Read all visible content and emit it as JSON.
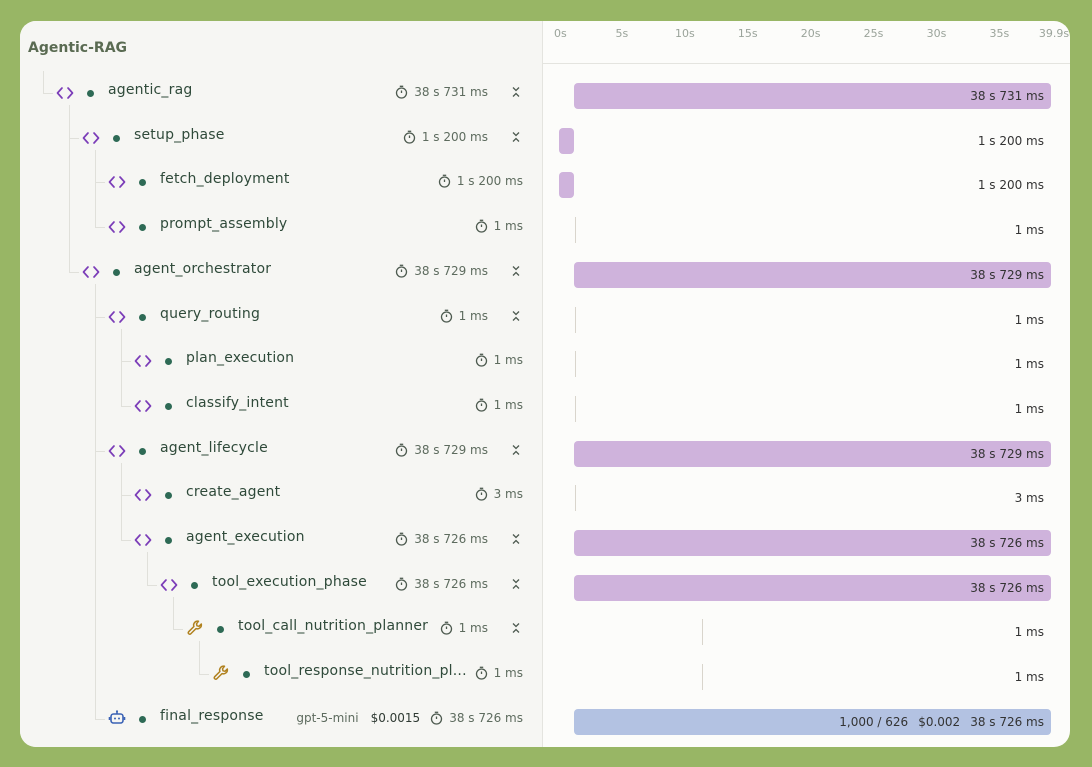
{
  "trace_title": "Agentic-RAG",
  "axis_ticks": [
    "0s",
    "5s",
    "10s",
    "15s",
    "20s",
    "25s",
    "30s",
    "35s",
    "39.9s"
  ],
  "colors": {
    "span_bar": "#cfb3dc",
    "llm_bar": "#b3c2e2",
    "code_icon": "#7b3db8",
    "tool_icon": "#b0811e",
    "dot": "#2e6a55",
    "background": "#98b665"
  },
  "rows": [
    {
      "name": "agentic_rag",
      "icon": "code-icon",
      "duration": "38 s 731 ms",
      "collapsible": true,
      "bar_label": "38 s 731 ms",
      "start_s": 1.2,
      "duration_s": 38.731
    },
    {
      "name": "setup_phase",
      "icon": "code-icon",
      "duration": "1 s 200 ms",
      "collapsible": true,
      "bar_label": "1 s 200 ms",
      "start_s": 0,
      "duration_s": 1.2
    },
    {
      "name": "fetch_deployment",
      "icon": "code-icon",
      "duration": "1 s 200 ms",
      "collapsible": false,
      "bar_label": "1 s 200 ms",
      "start_s": 0,
      "duration_s": 1.2
    },
    {
      "name": "prompt_assembly",
      "icon": "code-icon",
      "duration": "1 ms",
      "collapsible": false,
      "bar_label": "1 ms",
      "start_s": 1.2,
      "duration_s": 0.001
    },
    {
      "name": "agent_orchestrator",
      "icon": "code-icon",
      "duration": "38 s 729 ms",
      "collapsible": true,
      "bar_label": "38 s 729 ms",
      "start_s": 1.2,
      "duration_s": 38.729
    },
    {
      "name": "query_routing",
      "icon": "code-icon",
      "duration": "1 ms",
      "collapsible": true,
      "bar_label": "1 ms",
      "start_s": 1.2,
      "duration_s": 0.001
    },
    {
      "name": "plan_execution",
      "icon": "code-icon",
      "duration": "1 ms",
      "collapsible": false,
      "bar_label": "1 ms",
      "start_s": 1.2,
      "duration_s": 0.001
    },
    {
      "name": "classify_intent",
      "icon": "code-icon",
      "duration": "1 ms",
      "collapsible": false,
      "bar_label": "1 ms",
      "start_s": 1.2,
      "duration_s": 0.001
    },
    {
      "name": "agent_lifecycle",
      "icon": "code-icon",
      "duration": "38 s 729 ms",
      "collapsible": true,
      "bar_label": "38 s 729 ms",
      "start_s": 1.2,
      "duration_s": 38.729
    },
    {
      "name": "create_agent",
      "icon": "code-icon",
      "duration": "3 ms",
      "collapsible": false,
      "bar_label": "3 ms",
      "start_s": 1.2,
      "duration_s": 0.003
    },
    {
      "name": "agent_execution",
      "icon": "code-icon",
      "duration": "38 s 726 ms",
      "collapsible": true,
      "bar_label": "38 s 726 ms",
      "start_s": 1.2,
      "duration_s": 38.726
    },
    {
      "name": "tool_execution_phase",
      "icon": "code-icon",
      "duration": "38 s 726 ms",
      "collapsible": true,
      "bar_label": "38 s 726 ms",
      "start_s": 1.2,
      "duration_s": 38.726
    },
    {
      "name": "tool_call_nutrition_planner",
      "icon": "wrench-icon",
      "duration": "1 ms",
      "collapsible": true,
      "bar_label": "1 ms",
      "start_s": 11.5,
      "duration_s": 0.001
    },
    {
      "name": "tool_response_nutrition_pl...",
      "icon": "wrench-icon",
      "duration": "1 ms",
      "collapsible": false,
      "bar_label": "1 ms",
      "start_s": 11.5,
      "duration_s": 0.001
    },
    {
      "name": "final_response",
      "icon": "bot-icon",
      "model": "gpt-5-mini",
      "cost": "$0.0015",
      "duration": "38 s 726 ms",
      "collapsible": false,
      "bar_tokens": "1,000 / 626",
      "bar_cost": "$0.002",
      "bar_label": "38 s 726 ms",
      "start_s": 1.2,
      "duration_s": 38.726
    }
  ]
}
